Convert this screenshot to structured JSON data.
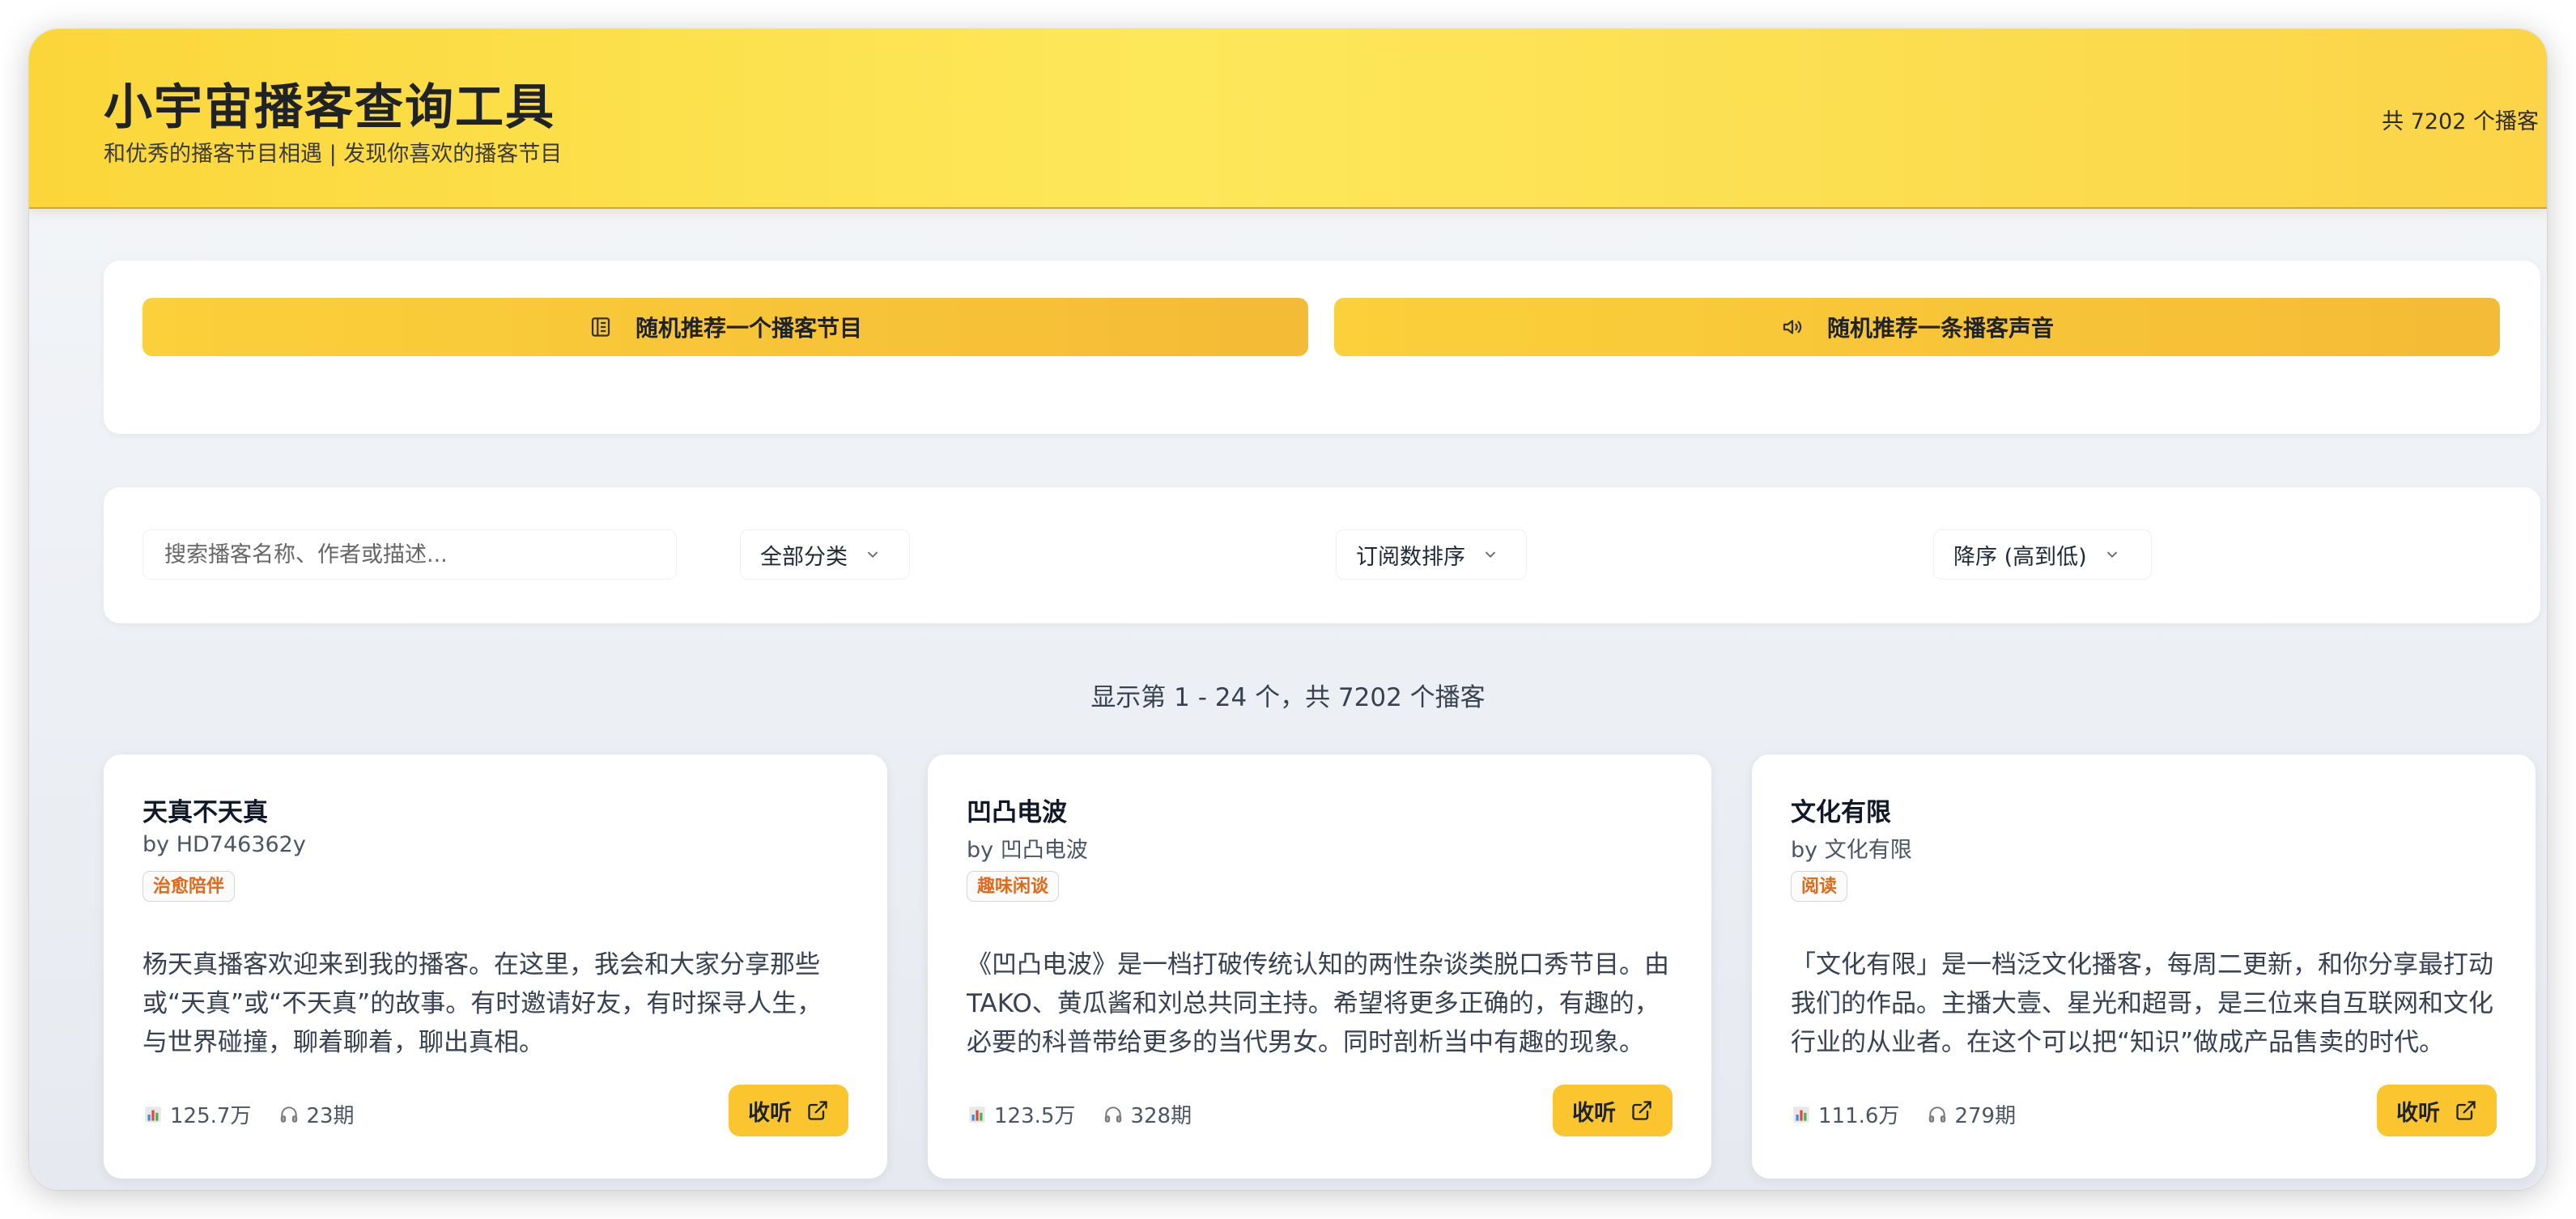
{
  "header": {
    "title": "小宇宙播客查询工具",
    "subtitle": "和优秀的播客节目相遇 | 发现你喜欢的播客节目",
    "total": "共 7202 个播客"
  },
  "random": {
    "podcast_label": "随机推荐一个播客节目",
    "voice_label": "随机推荐一条播客声音"
  },
  "filters": {
    "search_placeholder": "搜索播客名称、作者或描述...",
    "search_value": "",
    "category": "全部分类",
    "sort": "订阅数排序",
    "order": "降序 (高到低)"
  },
  "result_info": "显示第 1 - 24 个，共 7202 个播客",
  "cards": [
    {
      "title": "天真不天真",
      "author": "by HD746362y",
      "tag": "治愈陪伴",
      "desc": "杨天真播客欢迎来到我的播客。在这里，我会和大家分享那些或“天真”或“不天真”的故事。有时邀请好友，有时探寻人生，与世界碰撞，聊着聊着，聊出真相。",
      "subscribers": "125.7万",
      "episodes": "23期",
      "listen_label": "收听"
    },
    {
      "title": "凹凸电波",
      "author": "by 凹凸电波",
      "tag": "趣味闲谈",
      "desc": "《凹凸电波》是一档打破传统认知的两性杂谈类脱口秀节目。由TAKO、黄瓜酱和刘总共同主持。希望将更多正确的，有趣的，必要的科普带给更多的当代男女。同时剖析当中有趣的现象。",
      "subscribers": "123.5万",
      "episodes": "328期",
      "listen_label": "收听"
    },
    {
      "title": "文化有限",
      "author": "by 文化有限",
      "tag": "阅读",
      "desc": "「文化有限」是一档泛文化播客，每周二更新，和你分享最打动我们的作品。主播大壹、星光和超哥，是三位来自互联网和文化行业的从业者。在这个可以把“知识”做成产品售卖的时代。",
      "subscribers": "111.6万",
      "episodes": "279期",
      "listen_label": "收听"
    }
  ],
  "colors": {
    "header_yellow": "#fde85a",
    "button_yellow": "#fbc52f",
    "tag_orange": "#e06a1a"
  }
}
